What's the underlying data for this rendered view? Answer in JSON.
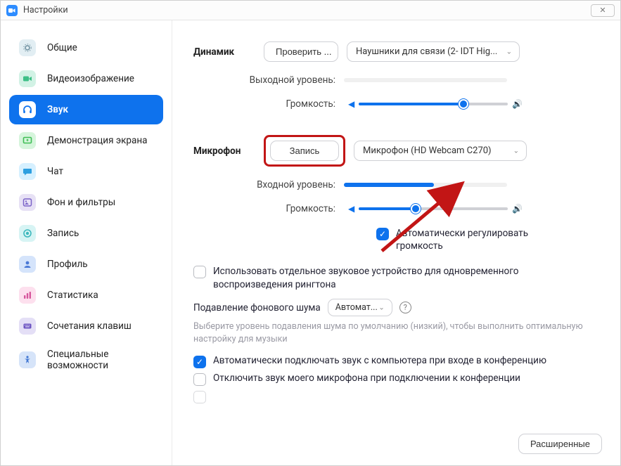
{
  "window": {
    "title": "Настройки"
  },
  "sidebar": {
    "items": [
      {
        "label": "Общие"
      },
      {
        "label": "Видеоизображение"
      },
      {
        "label": "Звук"
      },
      {
        "label": "Демонстрация экрана"
      },
      {
        "label": "Чат"
      },
      {
        "label": "Фон и фильтры"
      },
      {
        "label": "Запись"
      },
      {
        "label": "Профиль"
      },
      {
        "label": "Статистика"
      },
      {
        "label": "Сочетания клавиш"
      },
      {
        "label": "Специальные возможности"
      }
    ],
    "active_index": 2
  },
  "speaker": {
    "section": "Динамик",
    "test_btn": "Проверить ...",
    "device": "Наушники для связи (2- IDT Hig...",
    "output_level_label": "Выходной уровень:",
    "volume_label": "Громкость:",
    "volume_percent": 70
  },
  "mic": {
    "section": "Микрофон",
    "record_btn": "Запись",
    "device": "Микрофон (HD Webcam C270)",
    "input_level_label": "Входной уровень:",
    "input_level_percent": 55,
    "volume_label": "Громкость:",
    "volume_percent": 38,
    "auto_volume": "Автоматически регулировать громкость"
  },
  "options": {
    "separate_device": "Использовать отдельное звуковое устройство для одновременного воспроизведения рингтона",
    "noise_label": "Подавление фонового шума",
    "noise_value": "Автомат...",
    "noise_hint": "Выберите уровень подавления шума по умолчанию (низкий), чтобы выполнить оптимальную настройку для музыки",
    "auto_join_audio": "Автоматически подключать звук с компьютера при входе в конференцию",
    "mute_on_join": "Отключить звук моего микрофона при подключении к конференции"
  },
  "footer": {
    "advanced": "Расширенные"
  }
}
